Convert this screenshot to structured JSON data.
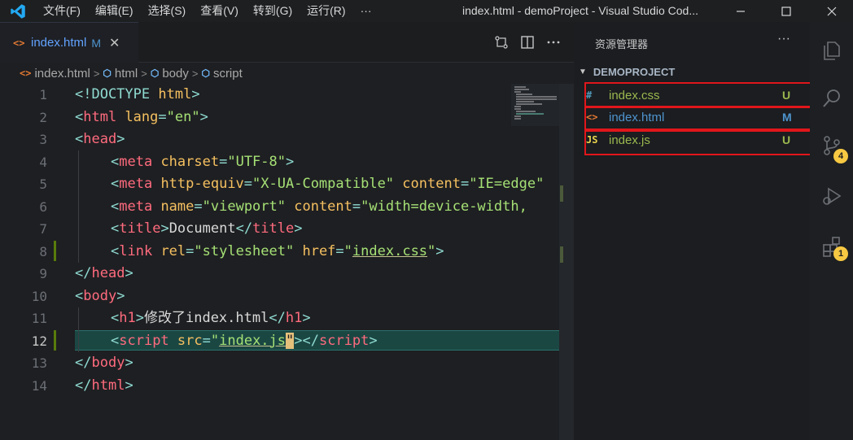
{
  "titlebar": {
    "menu": [
      "文件(F)",
      "编辑(E)",
      "选择(S)",
      "查看(V)",
      "转到(G)",
      "运行(R)",
      "···"
    ],
    "title": "index.html - demoProject - Visual Studio Cod...",
    "logo_color": "#23a9f2"
  },
  "tab": {
    "icon": "<>",
    "label": "index.html",
    "status": "M",
    "close": "✕"
  },
  "breadcrumb": {
    "file": "index.html",
    "items": [
      "html",
      "body",
      "script"
    ]
  },
  "editor": {
    "line_numbers": [
      "1",
      "2",
      "3",
      "4",
      "5",
      "6",
      "7",
      "8",
      "9",
      "10",
      "11",
      "12",
      "13",
      "14"
    ],
    "active_line": "12",
    "lines": {
      "l1_a": "<!DOCTYPE ",
      "l1_b": "html",
      "l1_c": ">",
      "l2_a": "<",
      "l2_b": "html",
      "l2_c": " lang",
      "l2_d": "=",
      "l2_e": "\"en\"",
      "l2_f": ">",
      "l3_a": "<",
      "l3_b": "head",
      "l3_c": ">",
      "l4_a": "<",
      "l4_b": "meta",
      "l4_c": " charset",
      "l4_d": "=",
      "l4_e": "\"UTF-8\"",
      "l4_f": ">",
      "l5_a": "<",
      "l5_b": "meta",
      "l5_c": " http-equiv",
      "l5_d": "=",
      "l5_e": "\"X-UA-Compatible\"",
      "l5_f": " content",
      "l5_g": "=",
      "l5_h": "\"IE=edge\"",
      "l6_a": "<",
      "l6_b": "meta",
      "l6_c": " name",
      "l6_d": "=",
      "l6_e": "\"viewport\"",
      "l6_f": " content",
      "l6_g": "=",
      "l6_h": "\"width=device-width,",
      "l7_a": "<",
      "l7_b": "title",
      "l7_c": ">",
      "l7_d": "Document",
      "l7_e": "</",
      "l7_f": "title",
      "l7_g": ">",
      "l8_a": "<",
      "l8_b": "link",
      "l8_c": " rel",
      "l8_d": "=",
      "l8_e": "\"stylesheet\"",
      "l8_f": " href",
      "l8_g": "=",
      "l8_h": "\"",
      "l8_i": "index.css",
      "l8_j": "\"",
      "l8_k": ">",
      "l9_a": "</",
      "l9_b": "head",
      "l9_c": ">",
      "l10_a": "<",
      "l10_b": "body",
      "l10_c": ">",
      "l11_a": "<",
      "l11_b": "h1",
      "l11_c": ">",
      "l11_d": "修改了index.html",
      "l11_e": "</",
      "l11_f": "h1",
      "l11_g": ">",
      "l12_a": "<",
      "l12_b": "script",
      "l12_c": " src",
      "l12_d": "=",
      "l12_e": "\"",
      "l12_f": "index.js",
      "l12_g": "\"",
      "l12_h": "></",
      "l12_i": "script",
      "l12_j": ">",
      "l13_a": "</",
      "l13_b": "body",
      "l13_c": ">",
      "l14_a": "</",
      "l14_b": "html",
      "l14_c": ">"
    }
  },
  "explorer": {
    "title": "资源管理器",
    "more": "···",
    "project": "DEMOPROJECT",
    "files": [
      {
        "icon": "#",
        "name": "index.css",
        "status": "U",
        "icon_color": "#519aba",
        "name_color": "#9ab84e",
        "status_color": "#9ab84e"
      },
      {
        "icon": "<>",
        "name": "index.html",
        "status": "M",
        "icon_color": "#e37933",
        "name_color": "#4e94ce",
        "status_color": "#4e94ce"
      },
      {
        "icon": "JS",
        "name": "index.js",
        "status": "U",
        "icon_color": "#e8d44d",
        "name_color": "#9ab84e",
        "status_color": "#9ab84e"
      }
    ]
  },
  "activity": {
    "icons": [
      "files-icon",
      "search-icon",
      "source-control-icon",
      "run-debug-icon",
      "extensions-icon"
    ],
    "source_control_badge": "4",
    "extensions_badge": "1"
  },
  "colors": {
    "highlight_box": "#e0161b",
    "badge": "#f7c842"
  }
}
